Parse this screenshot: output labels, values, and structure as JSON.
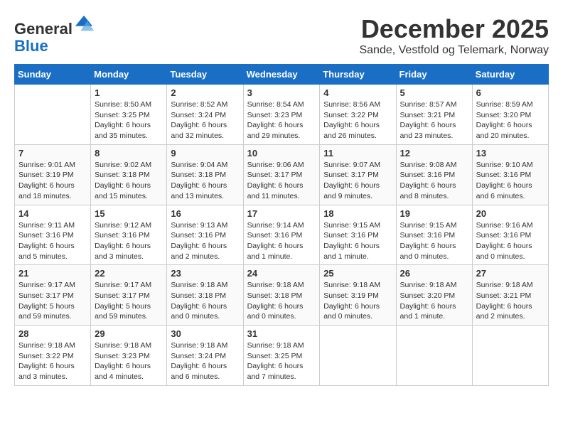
{
  "header": {
    "logo": {
      "line1": "General",
      "line2": "Blue"
    },
    "title": "December 2025",
    "location": "Sande, Vestfold og Telemark, Norway"
  },
  "days_of_week": [
    "Sunday",
    "Monday",
    "Tuesday",
    "Wednesday",
    "Thursday",
    "Friday",
    "Saturday"
  ],
  "weeks": [
    [
      {
        "day": "",
        "info": ""
      },
      {
        "day": "1",
        "info": "Sunrise: 8:50 AM\nSunset: 3:25 PM\nDaylight: 6 hours\nand 35 minutes."
      },
      {
        "day": "2",
        "info": "Sunrise: 8:52 AM\nSunset: 3:24 PM\nDaylight: 6 hours\nand 32 minutes."
      },
      {
        "day": "3",
        "info": "Sunrise: 8:54 AM\nSunset: 3:23 PM\nDaylight: 6 hours\nand 29 minutes."
      },
      {
        "day": "4",
        "info": "Sunrise: 8:56 AM\nSunset: 3:22 PM\nDaylight: 6 hours\nand 26 minutes."
      },
      {
        "day": "5",
        "info": "Sunrise: 8:57 AM\nSunset: 3:21 PM\nDaylight: 6 hours\nand 23 minutes."
      },
      {
        "day": "6",
        "info": "Sunrise: 8:59 AM\nSunset: 3:20 PM\nDaylight: 6 hours\nand 20 minutes."
      }
    ],
    [
      {
        "day": "7",
        "info": "Sunrise: 9:01 AM\nSunset: 3:19 PM\nDaylight: 6 hours\nand 18 minutes."
      },
      {
        "day": "8",
        "info": "Sunrise: 9:02 AM\nSunset: 3:18 PM\nDaylight: 6 hours\nand 15 minutes."
      },
      {
        "day": "9",
        "info": "Sunrise: 9:04 AM\nSunset: 3:18 PM\nDaylight: 6 hours\nand 13 minutes."
      },
      {
        "day": "10",
        "info": "Sunrise: 9:06 AM\nSunset: 3:17 PM\nDaylight: 6 hours\nand 11 minutes."
      },
      {
        "day": "11",
        "info": "Sunrise: 9:07 AM\nSunset: 3:17 PM\nDaylight: 6 hours\nand 9 minutes."
      },
      {
        "day": "12",
        "info": "Sunrise: 9:08 AM\nSunset: 3:16 PM\nDaylight: 6 hours\nand 8 minutes."
      },
      {
        "day": "13",
        "info": "Sunrise: 9:10 AM\nSunset: 3:16 PM\nDaylight: 6 hours\nand 6 minutes."
      }
    ],
    [
      {
        "day": "14",
        "info": "Sunrise: 9:11 AM\nSunset: 3:16 PM\nDaylight: 6 hours\nand 5 minutes."
      },
      {
        "day": "15",
        "info": "Sunrise: 9:12 AM\nSunset: 3:16 PM\nDaylight: 6 hours\nand 3 minutes."
      },
      {
        "day": "16",
        "info": "Sunrise: 9:13 AM\nSunset: 3:16 PM\nDaylight: 6 hours\nand 2 minutes."
      },
      {
        "day": "17",
        "info": "Sunrise: 9:14 AM\nSunset: 3:16 PM\nDaylight: 6 hours\nand 1 minute."
      },
      {
        "day": "18",
        "info": "Sunrise: 9:15 AM\nSunset: 3:16 PM\nDaylight: 6 hours\nand 1 minute."
      },
      {
        "day": "19",
        "info": "Sunrise: 9:15 AM\nSunset: 3:16 PM\nDaylight: 6 hours\nand 0 minutes."
      },
      {
        "day": "20",
        "info": "Sunrise: 9:16 AM\nSunset: 3:16 PM\nDaylight: 6 hours\nand 0 minutes."
      }
    ],
    [
      {
        "day": "21",
        "info": "Sunrise: 9:17 AM\nSunset: 3:17 PM\nDaylight: 5 hours\nand 59 minutes."
      },
      {
        "day": "22",
        "info": "Sunrise: 9:17 AM\nSunset: 3:17 PM\nDaylight: 5 hours\nand 59 minutes."
      },
      {
        "day": "23",
        "info": "Sunrise: 9:18 AM\nSunset: 3:18 PM\nDaylight: 6 hours\nand 0 minutes."
      },
      {
        "day": "24",
        "info": "Sunrise: 9:18 AM\nSunset: 3:18 PM\nDaylight: 6 hours\nand 0 minutes."
      },
      {
        "day": "25",
        "info": "Sunrise: 9:18 AM\nSunset: 3:19 PM\nDaylight: 6 hours\nand 0 minutes."
      },
      {
        "day": "26",
        "info": "Sunrise: 9:18 AM\nSunset: 3:20 PM\nDaylight: 6 hours\nand 1 minute."
      },
      {
        "day": "27",
        "info": "Sunrise: 9:18 AM\nSunset: 3:21 PM\nDaylight: 6 hours\nand 2 minutes."
      }
    ],
    [
      {
        "day": "28",
        "info": "Sunrise: 9:18 AM\nSunset: 3:22 PM\nDaylight: 6 hours\nand 3 minutes."
      },
      {
        "day": "29",
        "info": "Sunrise: 9:18 AM\nSunset: 3:23 PM\nDaylight: 6 hours\nand 4 minutes."
      },
      {
        "day": "30",
        "info": "Sunrise: 9:18 AM\nSunset: 3:24 PM\nDaylight: 6 hours\nand 6 minutes."
      },
      {
        "day": "31",
        "info": "Sunrise: 9:18 AM\nSunset: 3:25 PM\nDaylight: 6 hours\nand 7 minutes."
      },
      {
        "day": "",
        "info": ""
      },
      {
        "day": "",
        "info": ""
      },
      {
        "day": "",
        "info": ""
      }
    ]
  ]
}
